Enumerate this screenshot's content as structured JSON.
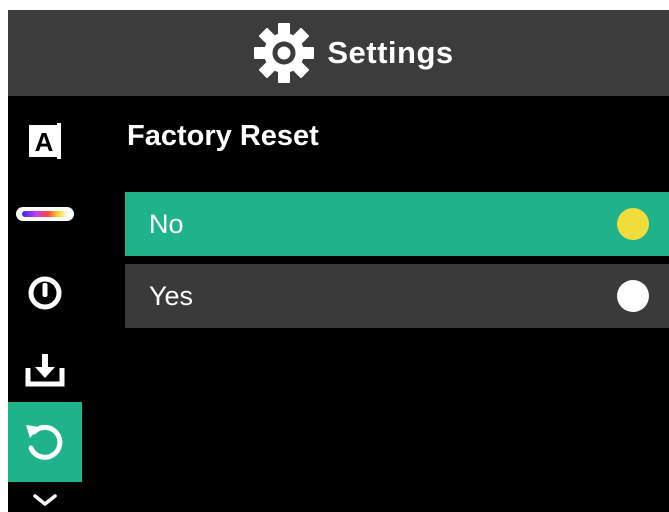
{
  "header": {
    "title": "Settings",
    "icon": "gear-icon"
  },
  "sidebar": {
    "items": [
      {
        "name": "auto-mode",
        "icon": "letter-a-icon",
        "glyph": "A",
        "active": false
      },
      {
        "name": "palette",
        "icon": "color-palette-bar-icon",
        "active": false
      },
      {
        "name": "power",
        "icon": "power-icon",
        "active": false
      },
      {
        "name": "save",
        "icon": "download-tray-icon",
        "active": false
      },
      {
        "name": "factory-reset",
        "icon": "reset-arrow-icon",
        "active": true
      },
      {
        "name": "more",
        "icon": "chevron-down-icon",
        "active": false
      }
    ]
  },
  "main": {
    "title": "Factory Reset",
    "options": [
      {
        "label": "No",
        "selected": true,
        "dot_color": "#f0dc3a"
      },
      {
        "label": "Yes",
        "selected": false,
        "dot_color": "#ffffff"
      }
    ]
  },
  "colors": {
    "accent": "#1fb38c",
    "header_bg": "#3c3c3c",
    "option_bg": "#3a3a3a",
    "background": "#000000"
  }
}
